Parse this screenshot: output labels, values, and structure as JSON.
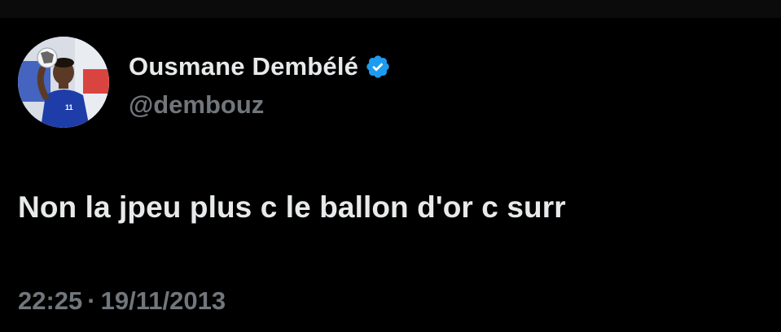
{
  "author": {
    "display_name": "Ousmane Dembélé",
    "handle": "@dembouz",
    "verified": true,
    "avatar_icon": "player-avatar",
    "verified_icon": "verified-badge-icon"
  },
  "tweet": {
    "text": "Non la jpeu plus c le ballon d'or c surr",
    "time": "22:25",
    "separator": "·",
    "date": "19/11/2013"
  },
  "colors": {
    "background": "#000000",
    "primary_text": "#e7e9ea",
    "secondary_text": "#71767b",
    "verified_blue": "#1d9bf0"
  }
}
